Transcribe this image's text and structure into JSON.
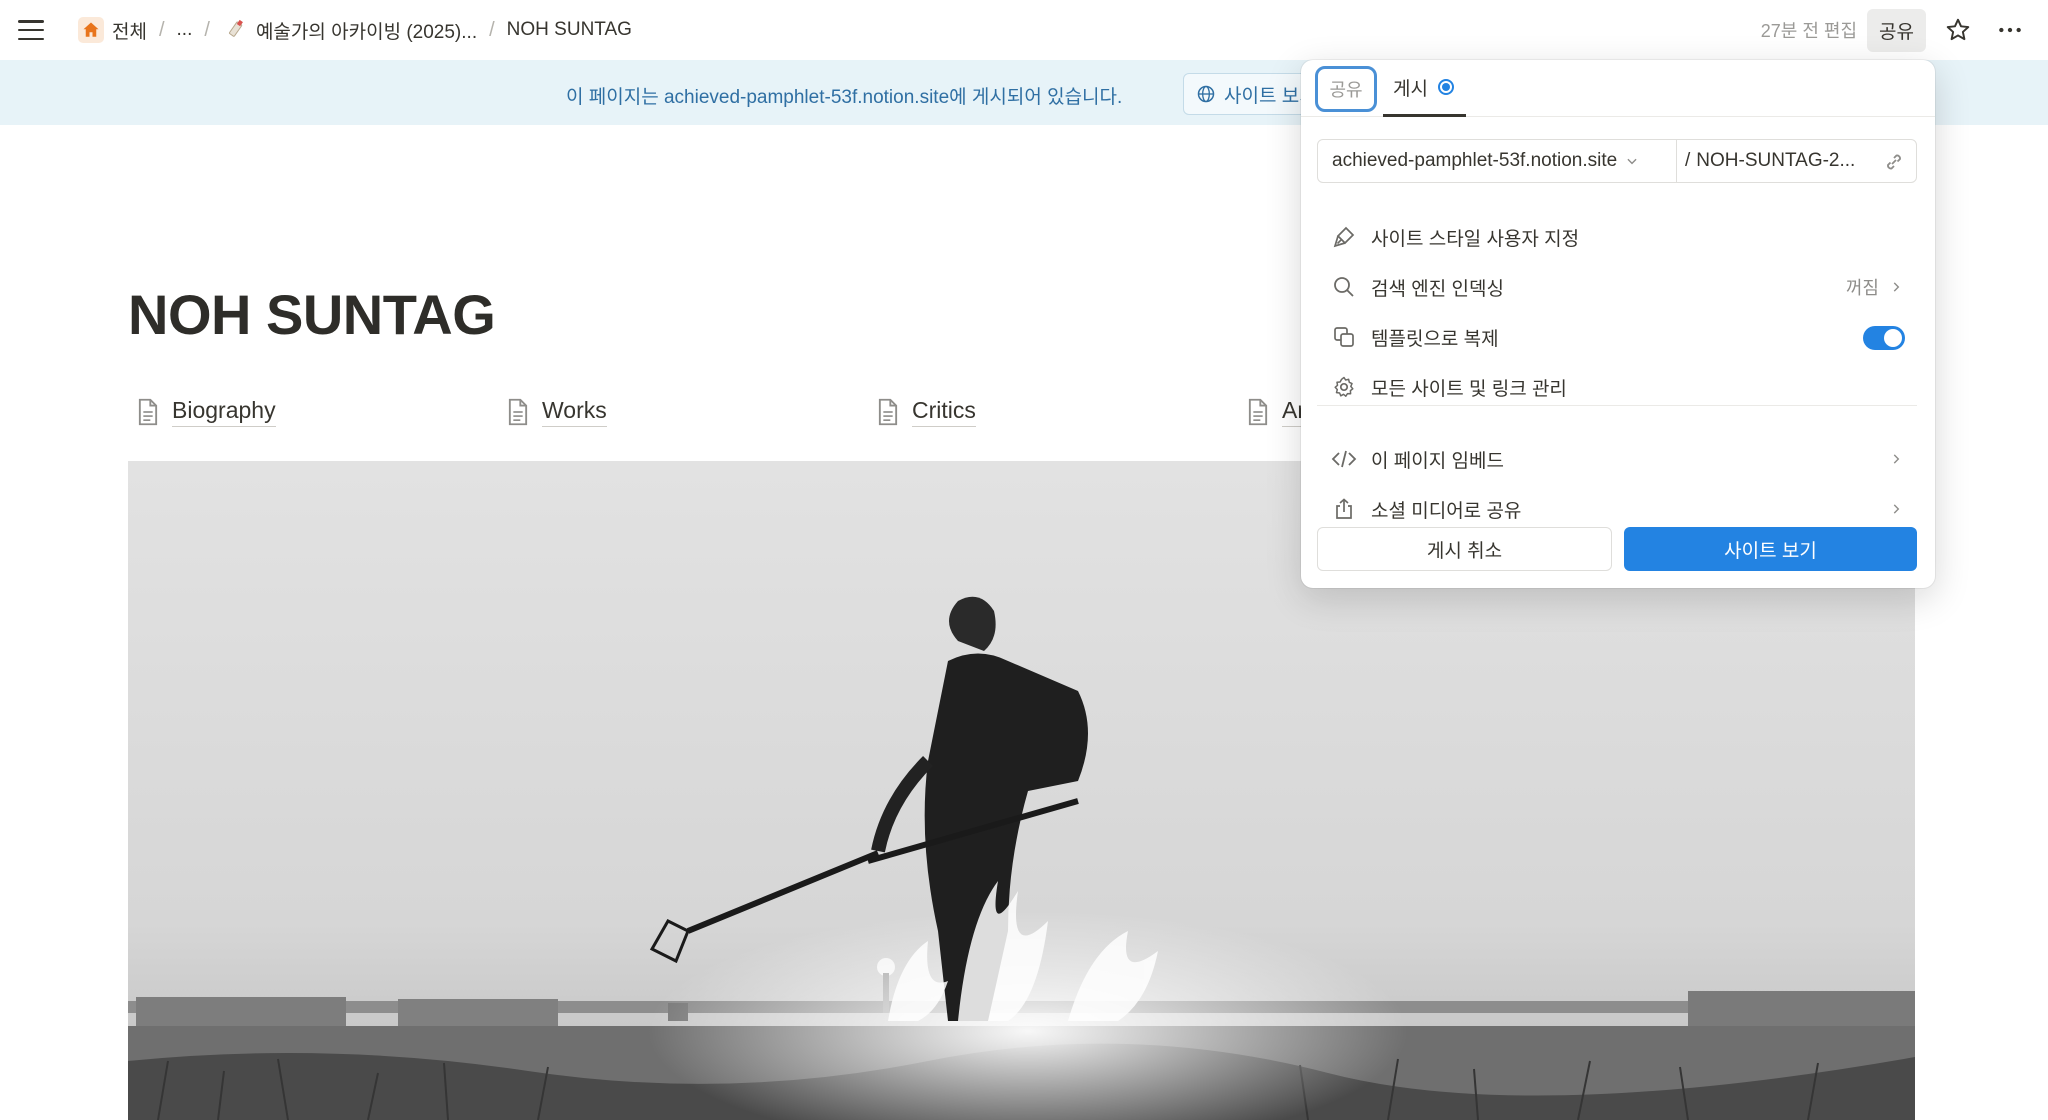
{
  "colors": {
    "accent": "#2383e2",
    "banner_bg": "#e7f3f8",
    "banner_text": "#2f6fa3",
    "home_icon_bg": "#fbe9d9",
    "home_icon": "#e8741b"
  },
  "topbar": {
    "breadcrumbs": [
      {
        "label": "전체",
        "icon": "home-icon"
      },
      {
        "label": "..."
      },
      {
        "label": "예술가의 아카이빙 (2025)...",
        "icon": "page-emoji-icon"
      },
      {
        "label": "NOH SUNTAG"
      }
    ],
    "edited": "27분 전 편집",
    "share_label": "공유"
  },
  "banner": {
    "text": "이 페이지는 achieved-pamphlet-53f.notion.site에 게시되어 있습니다.",
    "button_label": "사이트 보기"
  },
  "page": {
    "title": "NOH SUNTAG",
    "links": [
      {
        "label": "Biography"
      },
      {
        "label": "Works"
      },
      {
        "label": "Critics"
      },
      {
        "label": "Archive"
      }
    ]
  },
  "popup": {
    "tabs": {
      "share": "공유",
      "publish": "게시"
    },
    "url": {
      "domain": "achieved-pamphlet-53f.notion.site",
      "separator": "/",
      "slug": "NOH-SUNTAG-2..."
    },
    "items": [
      {
        "label": "사이트 스타일 사용자 지정",
        "icon": "paintbrush-icon"
      },
      {
        "label": "검색 엔진 인덱싱",
        "icon": "search-icon",
        "value": "꺼짐"
      },
      {
        "label": "템플릿으로 복제",
        "icon": "duplicate-icon",
        "toggle_on": true
      },
      {
        "label": "모든 사이트 및 링크 관리",
        "icon": "gear-icon"
      },
      {
        "label": "이 페이지 임베드",
        "icon": "code-icon"
      },
      {
        "label": "소셜 미디어로 공유",
        "icon": "share-icon"
      }
    ],
    "cancel_label": "게시 취소",
    "view_label": "사이트 보기"
  }
}
